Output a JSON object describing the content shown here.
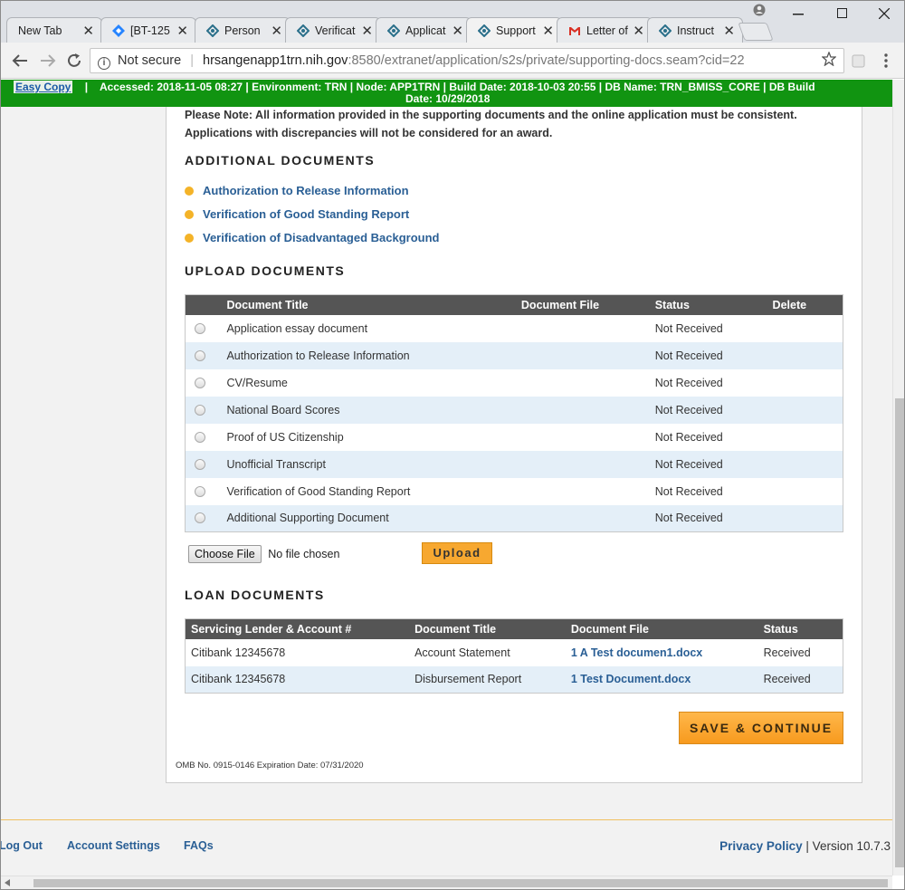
{
  "browser": {
    "tabs": [
      {
        "label": "New Tab"
      },
      {
        "label": "[BT-125"
      },
      {
        "label": "Person"
      },
      {
        "label": "Verificat"
      },
      {
        "label": "Applicat"
      },
      {
        "label": "Support"
      },
      {
        "label": "Letter of"
      },
      {
        "label": "Instruct"
      }
    ],
    "security": "Not secure",
    "url_host": "hrsangenapp1trn.nih.gov",
    "url_path": ":8580/extranet/application/s2s/private/supporting-docs.seam?cid=22",
    "close_glyph": "✕"
  },
  "env": {
    "easy_copy": "Easy Copy",
    "line1": "Accessed: 2018-11-05 08:27  |  Environment: TRN  |  Node: APP1TRN  |  Build Date: 2018-10-03 20:55  |  DB Name: TRN_BMISS_CORE  |  DB Build",
    "line2": "Date: 10/29/2018",
    "sep": "|"
  },
  "note": "Please Note: All information provided in the supporting documents and the online application must be consistent. Applications with discrepancies will not be considered for an award.",
  "additional": {
    "heading": "ADDITIONAL DOCUMENTS",
    "items": [
      "Authorization to Release Information",
      "Verification of Good Standing Report",
      "Verification of Disadvantaged Background"
    ]
  },
  "upload": {
    "heading": "UPLOAD DOCUMENTS",
    "columns": [
      "Document Title",
      "Document File",
      "Status",
      "Delete"
    ],
    "rows": [
      {
        "title": "Application essay document",
        "status": "Not Received"
      },
      {
        "title": "Authorization to Release Information",
        "status": "Not Received"
      },
      {
        "title": "CV/Resume",
        "status": "Not Received"
      },
      {
        "title": "National Board Scores",
        "status": "Not Received"
      },
      {
        "title": "Proof of US Citizenship",
        "status": "Not Received"
      },
      {
        "title": "Unofficial Transcript",
        "status": "Not Received"
      },
      {
        "title": "Verification of Good Standing Report",
        "status": "Not Received"
      },
      {
        "title": "Additional Supporting Document",
        "status": "Not Received"
      }
    ],
    "choose_file": "Choose File",
    "no_file": "No file chosen",
    "upload_button": "Upload"
  },
  "loan": {
    "heading": "LOAN DOCUMENTS",
    "columns": [
      "Servicing Lender & Account #",
      "Document Title",
      "Document File",
      "Status"
    ],
    "rows": [
      {
        "lender": "Citibank 12345678",
        "title": "Account Statement",
        "file": "1 A Test documen1.docx",
        "status": "Received"
      },
      {
        "lender": "Citibank 12345678",
        "title": "Disbursement Report",
        "file": "1 Test Document.docx",
        "status": "Received"
      }
    ]
  },
  "save_button": "SAVE & CONTINUE",
  "omb": "OMB No. 0915-0146 Expiration Date: 07/31/2020",
  "footer": {
    "logout": "Log Out",
    "account_settings": "Account Settings",
    "faqs": "FAQs",
    "privacy": "Privacy Policy",
    "version": "| Version 10.7.3"
  }
}
